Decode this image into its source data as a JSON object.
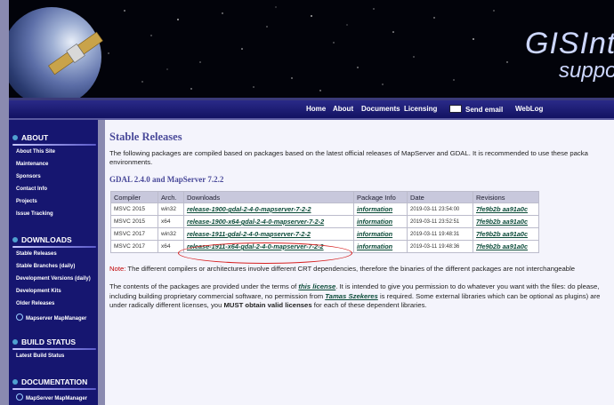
{
  "banner": {
    "logo_line1": "GISInte",
    "logo_line2": "suppor"
  },
  "nav": {
    "items": [
      "Home",
      "About",
      "Documents",
      "Licensing",
      "Send email",
      "WebLog"
    ]
  },
  "sidebar": {
    "about": {
      "title": "ABOUT",
      "links": [
        "About This Site",
        "Maintenance",
        "Sponsors",
        "Contact Info",
        "Projects",
        "Issue Tracking"
      ]
    },
    "downloads": {
      "title": "DOWNLOADS",
      "links": [
        "Stable Releases",
        "Stable Branches (daily)",
        "Development Versions (daily)",
        "Development Kits",
        "Older Releases",
        "Mapserver MapManager"
      ]
    },
    "build": {
      "title": "BUILD STATUS",
      "links": [
        "Latest Build Status"
      ]
    },
    "docs": {
      "title": "DOCUMENTATION",
      "links": [
        "MapServer MapManager"
      ]
    }
  },
  "main": {
    "title": "Stable Releases",
    "intro": "The following packages are compiled based on packages based on the latest official releases of MapServer and GDAL. It is recommended to use these packa environments.",
    "subtitle": "GDAL 2.4.0 and MapServer 7.2.2",
    "table": {
      "headers": [
        "Compiler",
        "Arch.",
        "Downloads",
        "Package Info",
        "Date",
        "Revisions"
      ],
      "rows": [
        [
          "MSVC 2015",
          "win32",
          "release-1900-gdal-2-4-0-mapserver-7-2-2",
          "information",
          "2019-03-11 23:54:00",
          "7fe9b2b aa91a0c"
        ],
        [
          "MSVC 2015",
          "x64",
          "release-1900-x64-gdal-2-4-0-mapserver-7-2-2",
          "information",
          "2019-03-11 23:52:51",
          "7fe9b2b aa91a0c"
        ],
        [
          "MSVC 2017",
          "win32",
          "release-1911-gdal-2-4-0-mapserver-7-2-2",
          "information",
          "2019-03-11 19:48:31",
          "7fe9b2b aa91a0c"
        ],
        [
          "MSVC 2017",
          "x64",
          "release-1911-x64-gdal-2-4-0-mapserver-7-2-2",
          "information",
          "2019-03-11 19:48:36",
          "7fe9b2b aa91a0c"
        ]
      ]
    },
    "note_label": "Note:",
    "note_text": " The different compilers or architectures involve different CRT dependencies, therefore the binaries of the different packages are not interchangeable",
    "contents": {
      "p1": "The contents of the packages are provided under the terms of ",
      "license": "this license",
      "p2": ". It is intended to give you permission to do whatever you want with the files: do please, including building proprietary commercial software, no permission from ",
      "author": "Tamas Szekeres",
      "p3": " is required. Some external libraries which can be optional as plugins) are under radically different licenses, you ",
      "must": "MUST obtain valid licenses",
      "p4": " for each of these dependent libraries."
    }
  },
  "colors": {
    "accent": "#4a4a9a",
    "nav": "#1a1a78",
    "highlight": "#d62020",
    "link": "#0a4a38"
  }
}
